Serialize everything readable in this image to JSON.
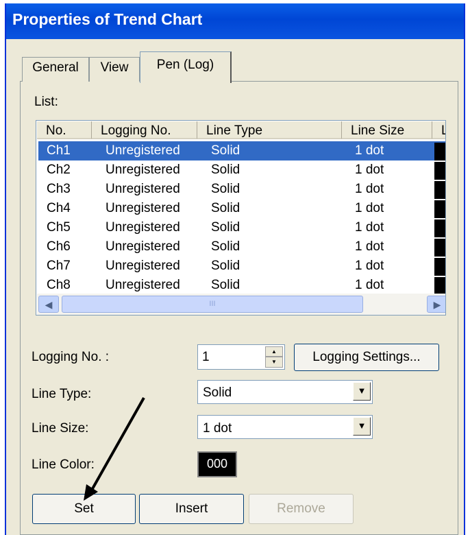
{
  "window": {
    "title": "Properties of Trend Chart"
  },
  "tabs": [
    {
      "label": "General",
      "active": false
    },
    {
      "label": "View",
      "active": false
    },
    {
      "label": "Pen (Log)",
      "active": true
    }
  ],
  "list": {
    "label": "List:",
    "columns": [
      "No.",
      "Logging No.",
      "Line Type",
      "Line Size",
      "L"
    ],
    "rows": [
      {
        "no": "Ch1",
        "logging": "Unregistered",
        "type": "Solid",
        "size": "1 dot",
        "color": "#000000",
        "selected": true
      },
      {
        "no": "Ch2",
        "logging": "Unregistered",
        "type": "Solid",
        "size": "1 dot",
        "color": "#000000"
      },
      {
        "no": "Ch3",
        "logging": "Unregistered",
        "type": "Solid",
        "size": "1 dot",
        "color": "#000000"
      },
      {
        "no": "Ch4",
        "logging": "Unregistered",
        "type": "Solid",
        "size": "1 dot",
        "color": "#000000"
      },
      {
        "no": "Ch5",
        "logging": "Unregistered",
        "type": "Solid",
        "size": "1 dot",
        "color": "#000000"
      },
      {
        "no": "Ch6",
        "logging": "Unregistered",
        "type": "Solid",
        "size": "1 dot",
        "color": "#000000"
      },
      {
        "no": "Ch7",
        "logging": "Unregistered",
        "type": "Solid",
        "size": "1 dot",
        "color": "#000000"
      },
      {
        "no": "Ch8",
        "logging": "Unregistered",
        "type": "Solid",
        "size": "1 dot",
        "color": "#000000"
      }
    ],
    "hscroll_thumb_grip": "III"
  },
  "form": {
    "logging_no_label": "Logging No. :",
    "logging_no_value": "1",
    "logging_settings_button": "Logging Settings...",
    "line_type_label": "Line Type:",
    "line_type_value": "Solid",
    "line_size_label": "Line Size:",
    "line_size_value": "1 dot",
    "line_color_label": "Line Color:",
    "line_color_value": "000",
    "line_color_swatch": "#000000"
  },
  "buttons": {
    "set": "Set",
    "insert": "Insert",
    "remove": "Remove"
  },
  "colors": {
    "titlebar": "#0054E3",
    "selection": "#316AC5",
    "dialog_bg": "#ECE9D8",
    "annotation_arrow": "#000000"
  }
}
